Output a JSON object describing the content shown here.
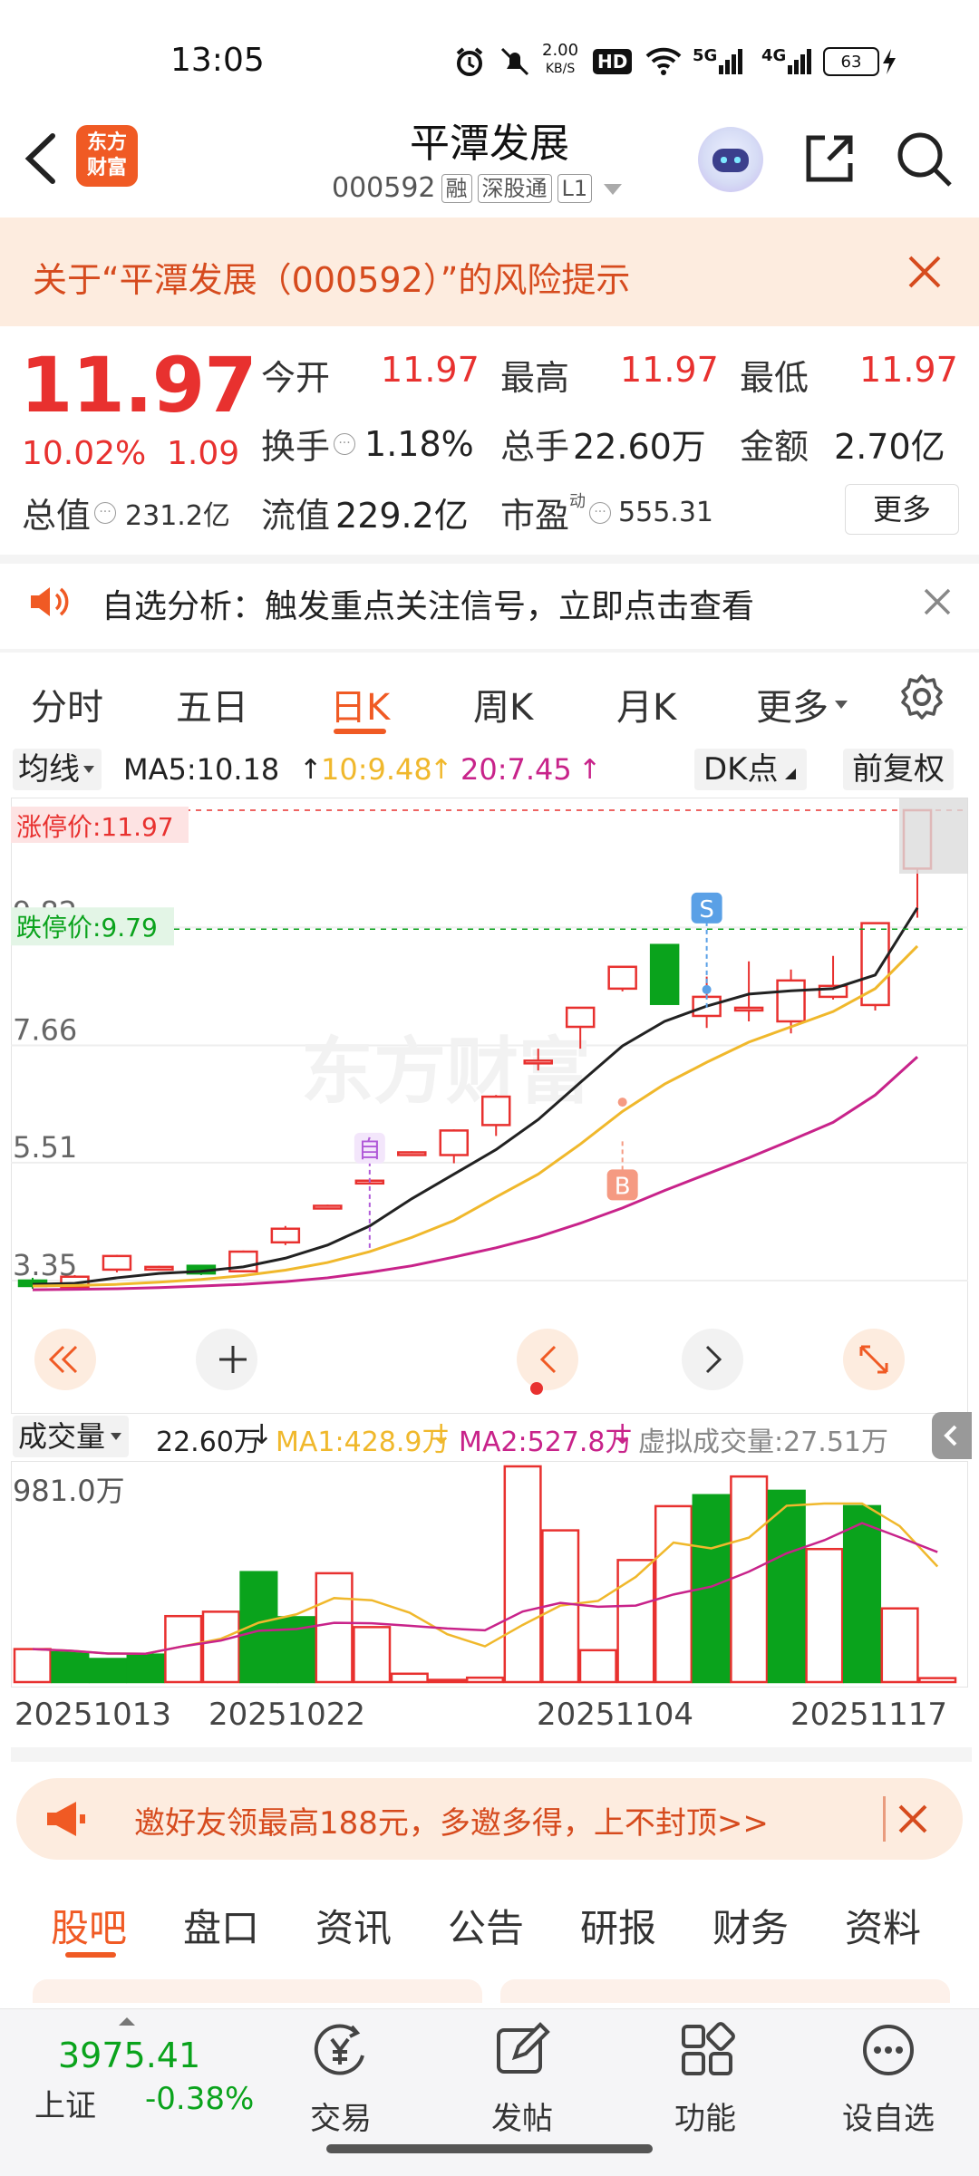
{
  "status_bar": {
    "time": "13:05",
    "speed_value": "2.00",
    "speed_unit": "KB/S",
    "hd": "HD",
    "net1": "5G",
    "net2": "4G",
    "battery": "63"
  },
  "header": {
    "name": "平潭发展",
    "code": "000592",
    "tags": [
      "融",
      "深股通",
      "L1"
    ],
    "logo_line1": "东方",
    "logo_line2": "财富"
  },
  "risk_banner": {
    "text": "关于“平潭发展（000592）”的风险提示"
  },
  "quote": {
    "price": "11.97",
    "pct": "10.02%",
    "change": "1.09",
    "open_label": "今开",
    "open": "11.97",
    "high_label": "最高",
    "high": "11.97",
    "low_label": "最低",
    "low": "11.97",
    "turnover_label": "换手",
    "turnover": "1.18%",
    "volume_label": "总手",
    "volume": "22.60万",
    "amount_label": "金额",
    "amount": "2.70亿",
    "mktcap_label": "总值",
    "mktcap": "231.2亿",
    "float_label": "流值",
    "float": "229.2亿",
    "pe_label": "市盈",
    "pe_sup": "动",
    "pe": "555.31",
    "more": "更多"
  },
  "analysis_banner": {
    "text": "自选分析：触发重点关注信号，立即点击查看"
  },
  "tabs": [
    "分时",
    "五日",
    "日K",
    "周K",
    "月K",
    "更多"
  ],
  "ma": {
    "select": "均线",
    "ma5": "MA5:10.18",
    "ma10": "10:9.48",
    "ma20": "20:7.45",
    "dk": "DK点",
    "fq": "前复权"
  },
  "chart_labels": {
    "limit_up": "涨停价:11.97",
    "limit_down": "跌停价:9.79",
    "y_ticks": [
      "9.82",
      "7.66",
      "5.51",
      "3.35"
    ],
    "watermark": "东方财富",
    "sell": "S",
    "buy": "B",
    "self": "自"
  },
  "volume_bar": {
    "select": "成交量",
    "vol": "22.60万",
    "ma1": "MA1:428.9万",
    "ma2": "MA2:527.8万",
    "virtual": "虚拟成交量:27.51万",
    "max": "981.0万"
  },
  "dates": [
    "20251013",
    "20251022",
    "20251104",
    "20251117"
  ],
  "invite": {
    "text": "邀好友领最高188元，多邀多得，上不封顶>>"
  },
  "bottom_tabs": [
    "股吧",
    "盘口",
    "资讯",
    "公告",
    "研报",
    "财务",
    "资料"
  ],
  "footer": {
    "index_value": "3975.41",
    "index_name": "上证",
    "index_pct": "-0.38%",
    "nav": [
      "交易",
      "发帖",
      "功能",
      "设自选"
    ]
  },
  "colors": {
    "up": "#e8312f",
    "down": "#0aa31c",
    "accent": "#f05a24",
    "ma5": "#222222",
    "ma10": "#f0b82c",
    "ma20": "#c8238a"
  },
  "chart_data": {
    "type": "candlestick",
    "y_ticks": [
      9.82,
      7.66,
      5.51,
      3.35
    ],
    "ylim": [
      3.1,
      11.97
    ],
    "dates_shown": [
      "20251013",
      "20251022",
      "20251104",
      "20251117"
    ],
    "candles": [
      {
        "o": 3.35,
        "c": 3.25,
        "h": 3.4,
        "l": 3.2
      },
      {
        "o": 3.23,
        "c": 3.42,
        "h": 3.45,
        "l": 3.2
      },
      {
        "o": 3.55,
        "c": 3.8,
        "h": 3.82,
        "l": 3.5
      },
      {
        "o": 3.6,
        "c": 3.6,
        "h": 3.62,
        "l": 3.58
      },
      {
        "o": 3.62,
        "c": 3.48,
        "h": 3.64,
        "l": 3.45
      },
      {
        "o": 3.52,
        "c": 3.88,
        "h": 3.9,
        "l": 3.5
      },
      {
        "o": 4.05,
        "c": 4.3,
        "h": 4.35,
        "l": 4.0
      },
      {
        "o": 4.72,
        "c": 4.72,
        "h": 4.74,
        "l": 4.7
      },
      {
        "o": 5.18,
        "c": 5.18,
        "h": 5.2,
        "l": 5.16
      },
      {
        "o": 5.7,
        "c": 5.7,
        "h": 5.72,
        "l": 5.68
      },
      {
        "o": 5.65,
        "c": 6.1,
        "h": 6.12,
        "l": 5.5
      },
      {
        "o": 6.2,
        "c": 6.72,
        "h": 6.75,
        "l": 6.0
      },
      {
        "o": 7.38,
        "c": 7.38,
        "h": 7.6,
        "l": 7.2
      },
      {
        "o": 8.0,
        "c": 8.35,
        "h": 8.35,
        "l": 7.6
      },
      {
        "o": 8.7,
        "c": 9.1,
        "h": 9.1,
        "l": 8.65
      },
      {
        "o": 9.5,
        "c": 8.42,
        "h": 9.5,
        "l": 8.4
      },
      {
        "o": 8.2,
        "c": 8.55,
        "h": 8.92,
        "l": 7.98
      },
      {
        "o": 8.3,
        "c": 8.35,
        "h": 9.2,
        "l": 8.1
      },
      {
        "o": 8.1,
        "c": 8.85,
        "h": 9.05,
        "l": 7.88
      },
      {
        "o": 8.55,
        "c": 8.75,
        "h": 9.3,
        "l": 8.5
      },
      {
        "o": 8.4,
        "c": 9.9,
        "h": 9.9,
        "l": 8.3
      },
      {
        "o": 10.9,
        "c": 11.97,
        "h": 11.97,
        "l": 10.0
      }
    ],
    "ma5": [
      3.28,
      3.3,
      3.4,
      3.48,
      3.52,
      3.6,
      3.76,
      4.0,
      4.35,
      4.85,
      5.3,
      5.75,
      6.3,
      6.98,
      7.65,
      8.1,
      8.38,
      8.6,
      8.66,
      8.7,
      8.95,
      10.18
    ],
    "ma10": [
      3.25,
      3.26,
      3.28,
      3.32,
      3.37,
      3.44,
      3.54,
      3.68,
      3.88,
      4.14,
      4.45,
      4.88,
      5.3,
      5.85,
      6.45,
      6.95,
      7.35,
      7.72,
      8.0,
      8.28,
      8.7,
      9.48
    ],
    "ma20": [
      3.18,
      3.19,
      3.2,
      3.22,
      3.25,
      3.28,
      3.33,
      3.4,
      3.5,
      3.62,
      3.78,
      3.95,
      4.15,
      4.4,
      4.68,
      5.0,
      5.3,
      5.6,
      5.92,
      6.25,
      6.75,
      7.45
    ],
    "volume_max": 981.0,
    "volume_unit": "万",
    "volume": [
      150,
      135,
      105,
      125,
      300,
      320,
      500,
      295,
      495,
      250,
      38,
      10,
      20,
      981,
      690,
      145,
      555,
      800,
      850,
      935,
      870,
      605,
      800,
      335,
      18
    ],
    "volume_up": [
      true,
      false,
      false,
      false,
      true,
      true,
      false,
      false,
      true,
      true,
      true,
      true,
      true,
      true,
      true,
      true,
      true,
      true,
      false,
      true,
      false,
      true,
      false,
      true,
      true
    ]
  }
}
